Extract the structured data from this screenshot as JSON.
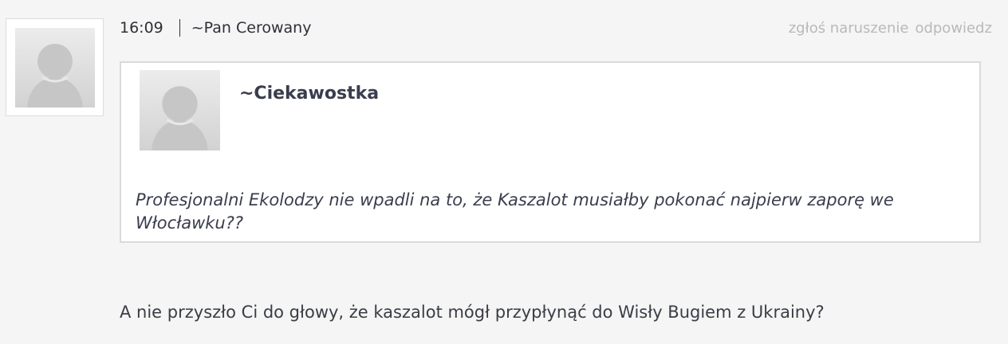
{
  "comment": {
    "time": "16:09",
    "author": "~Pan Cerowany",
    "actions": {
      "report": "zgłoś naruszenie",
      "reply": "odpowiedz"
    },
    "quote": {
      "author": "~Ciekawostka",
      "text": "Profesjonalni Ekolodzy nie wpadli na to, że Kaszalot musiałby pokonać najpierw zaporę we Włocławku??"
    },
    "body": "A nie przyszło Ci do głowy, że kaszalot mógł przypłynąć do Wisły Bugiem z Ukrainy?"
  },
  "icons": {
    "avatar": "default-user-avatar-icon",
    "quote_avatar": "default-user-avatar-icon"
  },
  "colors": {
    "background": "#f5f5f5",
    "text": "#3a3d45",
    "muted_actions": "#b9b9b9",
    "quote_border": "#dadada"
  }
}
